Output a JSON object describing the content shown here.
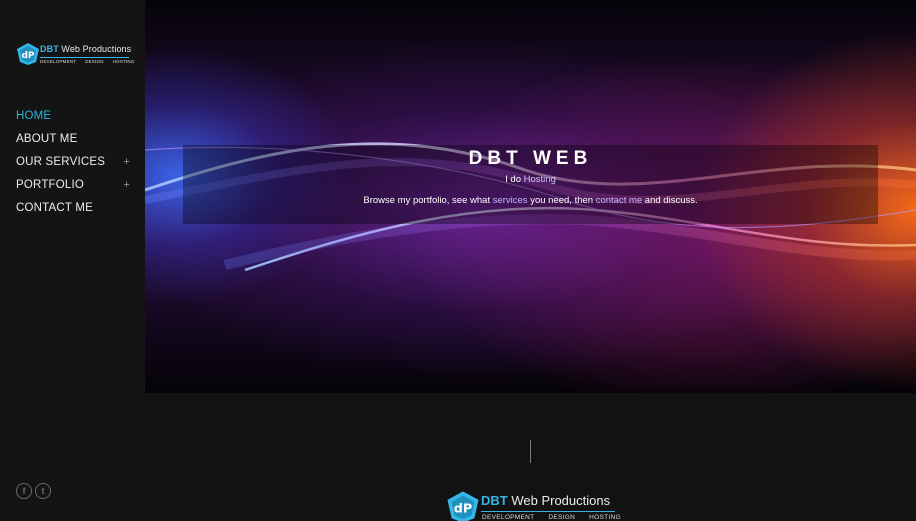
{
  "brand": {
    "title_accent": "DBT",
    "title_rest": " Web Productions",
    "tags": [
      "DEVELOPMENT",
      "DESIGN",
      "HOSTING"
    ],
    "mark_letters": "dP",
    "accent_color": "#35b6e6"
  },
  "nav": {
    "items": [
      {
        "label": "HOME",
        "active": true,
        "expandable": false
      },
      {
        "label": "ABOUT ME",
        "active": false,
        "expandable": false
      },
      {
        "label": "OUR SERVICES",
        "active": false,
        "expandable": true
      },
      {
        "label": "PORTFOLIO",
        "active": false,
        "expandable": true
      },
      {
        "label": "CONTACT ME",
        "active": false,
        "expandable": false
      }
    ],
    "expand_glyph": "+",
    "active_color": "#2ab4d8"
  },
  "social": {
    "facebook_glyph": "f",
    "twitter_glyph": "t",
    "icons": [
      "facebook-icon",
      "twitter-icon"
    ]
  },
  "hero": {
    "title": "DBT WEB",
    "tagline_prefix": "I do ",
    "tagline_word": "Hosting",
    "desc_1": "Browse my portfolio, see what ",
    "desc_link_services": "services",
    "desc_2": " you need, then ",
    "desc_link_contact": "contact me",
    "desc_3": " and discuss."
  }
}
